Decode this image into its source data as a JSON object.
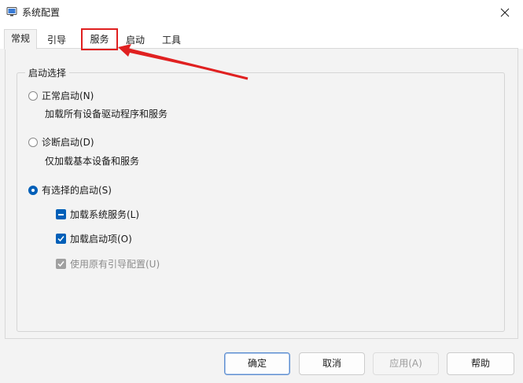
{
  "window": {
    "title": "系统配置"
  },
  "tabs": [
    {
      "label": "常规",
      "active": true
    },
    {
      "label": "引导"
    },
    {
      "label": "服务",
      "highlighted": true
    },
    {
      "label": "启动"
    },
    {
      "label": "工具"
    }
  ],
  "startup_group": {
    "legend": "启动选择",
    "normal": {
      "label": "正常启动(N)",
      "desc": "加载所有设备驱动程序和服务"
    },
    "diagnostic": {
      "label": "诊断启动(D)",
      "desc": "仅加载基本设备和服务"
    },
    "selective": {
      "label": "有选择的启动(S)",
      "options": [
        {
          "label": "加载系统服务(L)",
          "state": "indeterminate"
        },
        {
          "label": "加载启动项(O)",
          "state": "checked"
        },
        {
          "label": "使用原有引导配置(U)",
          "state": "checked-disabled"
        }
      ]
    },
    "selected": "selective"
  },
  "buttons": {
    "ok": "确定",
    "cancel": "取消",
    "apply": "应用(A)",
    "help": "帮助"
  },
  "colors": {
    "accent": "#005fb8",
    "annotation": "#e02020"
  }
}
